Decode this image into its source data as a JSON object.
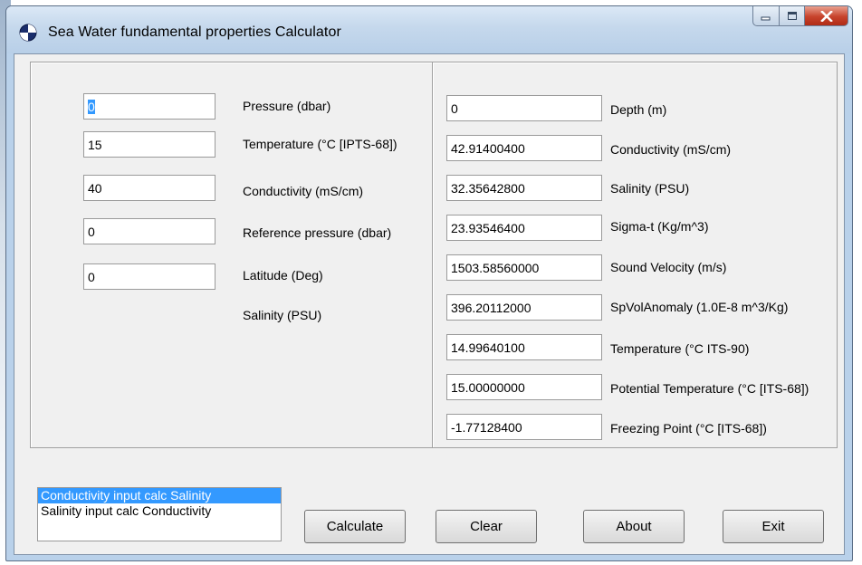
{
  "window": {
    "title": "Sea Water fundamental  properties Calculator",
    "icon": "globe-icon"
  },
  "inputs": [
    {
      "label": "Pressure (dbar)",
      "value": "0",
      "selected": true
    },
    {
      "label": "Temperature (°C [IPTS-68])",
      "value": "15"
    },
    {
      "label": "Conductivity (mS/cm)",
      "value": "40"
    },
    {
      "label": "Reference pressure (dbar)",
      "value": "0"
    },
    {
      "label": "Latitude (Deg)",
      "value": "0"
    },
    {
      "label": "Salinity (PSU)"
    }
  ],
  "outputs": [
    {
      "label": "Depth (m)",
      "value": "0"
    },
    {
      "label": "Conductivity (mS/cm)",
      "value": "42.91400400"
    },
    {
      "label": "Salinity (PSU)",
      "value": "32.35642800"
    },
    {
      "label": "Sigma-t (Kg/m^3)",
      "value": "23.93546400"
    },
    {
      "label": "Sound Velocity (m/s)",
      "value": "1503.58560000"
    },
    {
      "label": "SpVolAnomaly (1.0E-8 m^3/Kg)",
      "value": "396.20112000"
    },
    {
      "label": "Temperature (°C ITS-90)",
      "value": "14.99640100"
    },
    {
      "label": "Potential Temperature (°C [ITS-68])",
      "value": "15.00000000"
    },
    {
      "label": "Freezing Point (°C [ITS-68])",
      "value": "-1.77128400"
    }
  ],
  "mode_list": {
    "items": [
      "Conductivity input calc Salinity",
      "Salinity input calc Conductivity"
    ],
    "selected_index": 0
  },
  "buttons": {
    "calculate": "Calculate",
    "clear": "Clear",
    "about": "About",
    "exit": "Exit"
  },
  "colors": {
    "selection": "#3399ff",
    "close_button": "#c7422b"
  }
}
